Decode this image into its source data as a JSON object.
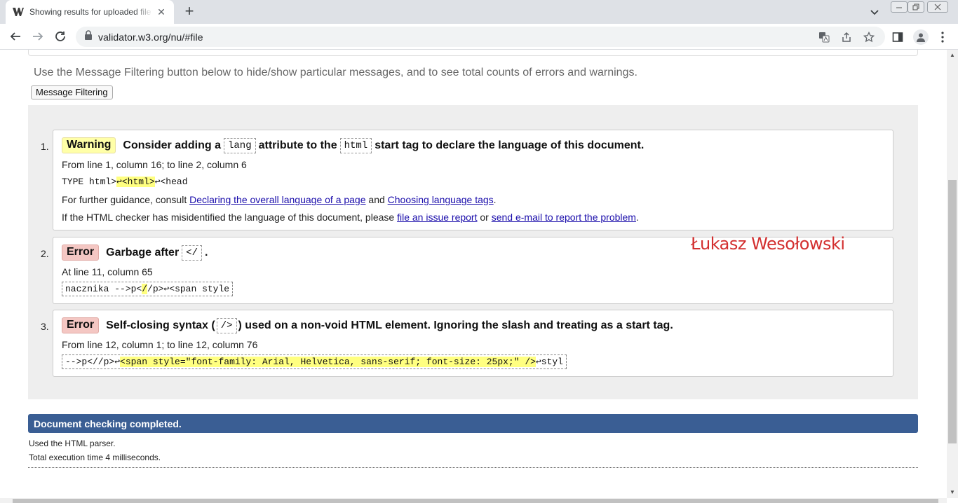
{
  "browser": {
    "tab_title": "Showing results for uploaded file",
    "url": "validator.w3.org/nu/#file"
  },
  "page": {
    "filter_note": "Use the Message Filtering button below to hide/show particular messages, and to see total counts of errors and warnings.",
    "filter_button": "Message Filtering",
    "messages": [
      {
        "num": "1.",
        "type": "Warning",
        "head": [
          "Consider adding a",
          "lang",
          "attribute to the",
          "html",
          "start tag to declare the language of this document."
        ],
        "location": "From line 1, column 16; to line 2, column 6",
        "extract": [
          "TYPE html>",
          "↩<html>",
          "↩<head"
        ],
        "guidance_prefix": "For further guidance, consult",
        "guidance_link1": "Declaring the overall language of a page",
        "guidance_and": "and",
        "guidance_link2": "Choosing language tags",
        "guidance_end": ".",
        "misid_prefix": "If the HTML checker has misidentified the language of this document, please",
        "misid_link1": "file an issue report",
        "misid_or": "or",
        "misid_link2": "send e-mail to report the problem",
        "misid_end": "."
      },
      {
        "num": "2.",
        "type": "Error",
        "head": [
          "Garbage after",
          "</",
          "."
        ],
        "location": "At line 11, column 65",
        "extract": [
          "nacznika -->p<",
          "/",
          "/p>↩<span style"
        ]
      },
      {
        "num": "3.",
        "type": "Error",
        "head": [
          "Self-closing syntax (",
          "/>",
          ") used on a non-void HTML element. Ignoring the slash and treating as a start tag."
        ],
        "location": "From line 12, column 1; to line 12, column 76",
        "extract": [
          "-->p<//p>↩",
          "<span style=\"font-family: Arial, Helvetica, sans-serif; font-size: 25px;\" />",
          "↩styl"
        ]
      }
    ],
    "watermark": "Łukasz Wesołowski",
    "done": "Document checking completed.",
    "parser": "Used the HTML parser.",
    "exec_time": "Total execution time 4 milliseconds."
  }
}
